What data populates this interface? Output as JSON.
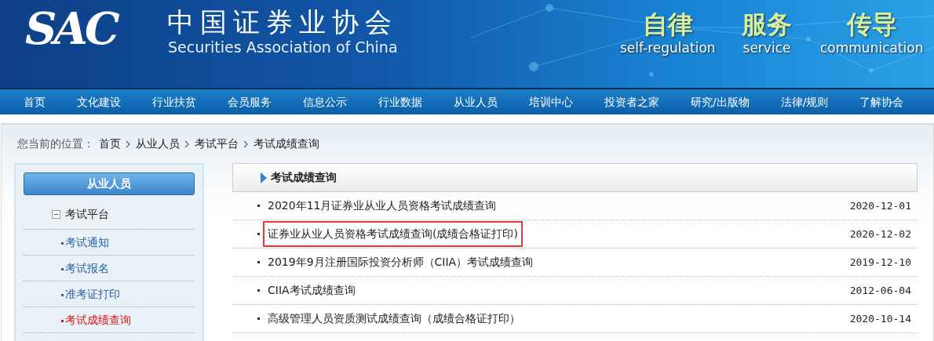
{
  "header": {
    "logo": "SAC",
    "title": "中国证券业协会",
    "subtitle": "Securities Association of China",
    "slogans": [
      {
        "cn": "自律",
        "en": "self-regulation"
      },
      {
        "cn": "服务",
        "en": "service"
      },
      {
        "cn": "传导",
        "en": "communication"
      }
    ]
  },
  "nav": [
    "首页",
    "文化建设",
    "行业扶贫",
    "会员服务",
    "信息公示",
    "行业数据",
    "从业人员",
    "培训中心",
    "投资者之家",
    "研究/出版物",
    "法律/规则",
    "了解协会"
  ],
  "breadcrumb": {
    "label": "您当前的位置：",
    "items": [
      "首页",
      "从业人员",
      "考试平台",
      "考试成绩查询"
    ]
  },
  "sidebar": {
    "heading": "从业人员",
    "group": {
      "label": "考试平台",
      "expanded": true,
      "children": [
        {
          "label": "考试通知",
          "selected": false
        },
        {
          "label": "考试报名",
          "selected": false
        },
        {
          "label": "准考证打印",
          "selected": false
        },
        {
          "label": "考试成绩查询",
          "selected": true
        }
      ]
    }
  },
  "content": {
    "title": "考试成绩查询",
    "items": [
      {
        "title": "2020年11月证券业从业人员资格考试成绩查询",
        "date": "2020-12-01",
        "highlighted": false
      },
      {
        "title": "证券业从业人员资格考试成绩查询(成绩合格证打印)",
        "date": "2020-12-02",
        "highlighted": true
      },
      {
        "title": "2019年9月注册国际投资分析师（CIIA）考试成绩查询",
        "date": "2019-12-10",
        "highlighted": false
      },
      {
        "title": "CIIA考试成绩查询",
        "date": "2012-06-04",
        "highlighted": false
      },
      {
        "title": "高级管理人员资质测试成绩查询（成绩合格证打印）",
        "date": "2020-10-14",
        "highlighted": false
      }
    ]
  }
}
